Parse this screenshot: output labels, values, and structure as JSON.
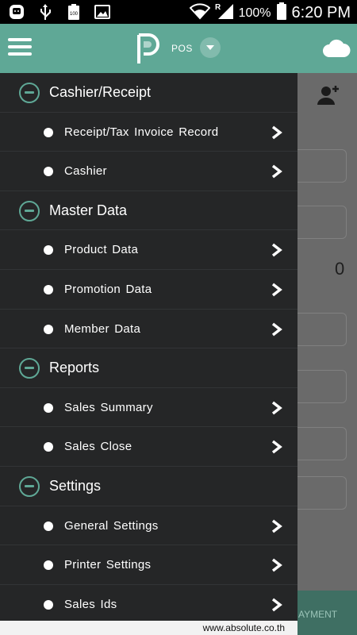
{
  "status_bar": {
    "battery_percent": "100%",
    "time": "6:20 PM",
    "left_icons": [
      "messenger-icon",
      "usb-icon",
      "battery-saver-icon",
      "image-icon"
    ],
    "right_icons": [
      "wifi-icon",
      "signal-icon",
      "battery-icon"
    ]
  },
  "app_bar": {
    "logo_letter": "P",
    "app_name": "POS",
    "accent_color": "#5fa896"
  },
  "background": {
    "zero_value": "0",
    "bottom_button_partial": "AYMENT"
  },
  "drawer": {
    "sections": [
      {
        "label": "Cashier/Receipt",
        "items": [
          "Receipt/Tax Invoice Record",
          "Cashier"
        ]
      },
      {
        "label": "Master Data",
        "items": [
          "Product Data",
          "Promotion Data",
          "Member Data"
        ]
      },
      {
        "label": "Reports",
        "items": [
          "Sales Summary",
          "Sales Close"
        ]
      },
      {
        "label": "Settings",
        "items": [
          "General Settings",
          "Printer Settings",
          "Sales Ids"
        ]
      }
    ]
  },
  "footer": {
    "url": "www.absolute.co.th"
  }
}
